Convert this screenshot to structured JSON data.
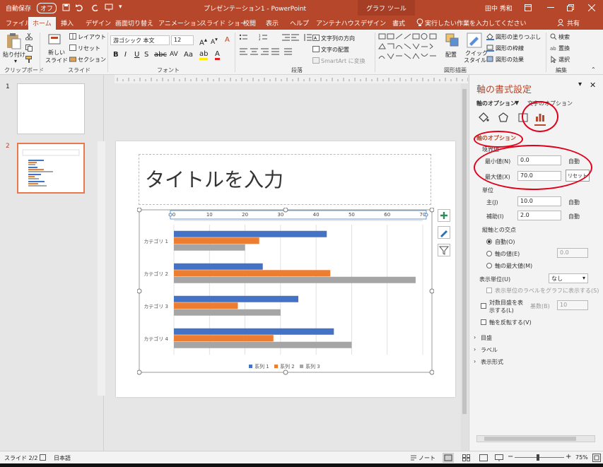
{
  "titlebar": {
    "autosave": "自動保存",
    "autosave_state": "オフ",
    "doc_title": "プレゼンテーション1 - PowerPoint",
    "context_tool": "グラフ ツール",
    "user": "田中 秀和"
  },
  "tabs": [
    "ファイル",
    "ホーム",
    "挿入",
    "デザイン",
    "画面切り替え",
    "アニメーション",
    "スライド ショー",
    "校閲",
    "表示",
    "ヘルプ",
    "アンテナハウス",
    "デザイン",
    "書式"
  ],
  "tell_me": "実行したい作業を入力してください",
  "share": "共有",
  "ribbon": {
    "clipboard": {
      "paste": "貼り付け",
      "group": "クリップボード"
    },
    "slides": {
      "new_slide": "新しい",
      "new_slide2": "スライド",
      "layout": "レイアウト",
      "reset": "リセット",
      "section": "セクション",
      "group": "スライド"
    },
    "font": {
      "name": "游ゴシック 本文",
      "size": "12",
      "group": "フォント"
    },
    "paragraph": {
      "text_dir": "文字列の方向",
      "align_text": "文字の配置",
      "smartart": "SmartArt に変換",
      "group": "段落"
    },
    "drawing": {
      "arrange": "配置",
      "quick_style": "クイック",
      "quick_style2": "スタイル",
      "fill": "図形の塗りつぶし",
      "outline": "図形の枠線",
      "effects": "図形の効果",
      "group": "図形描画"
    },
    "editing": {
      "find": "検索",
      "replace": "置換",
      "select": "選択",
      "group": "編集"
    }
  },
  "thumbnails": [
    {
      "num": "1"
    },
    {
      "num": "2"
    }
  ],
  "slide": {
    "title_placeholder": "タイトルを入力"
  },
  "chart_data": {
    "type": "bar",
    "orientation": "horizontal",
    "categories": [
      "カテゴリ 1",
      "カテゴリ 2",
      "カテゴリ 3",
      "カテゴリ 4"
    ],
    "series": [
      {
        "name": "系列 1",
        "color": "#4472c4",
        "values": [
          43,
          25,
          35,
          45
        ]
      },
      {
        "name": "系列 2",
        "color": "#ed7d31",
        "values": [
          24,
          44,
          18,
          28
        ]
      },
      {
        "name": "系列 3",
        "color": "#a5a5a5",
        "values": [
          20,
          68,
          30,
          50
        ]
      }
    ],
    "xlim": [
      0,
      70
    ],
    "ticks": [
      "0",
      "10",
      "20",
      "30",
      "40",
      "50",
      "60",
      "70"
    ],
    "axis_position": "top",
    "grid": true,
    "legend": "bottom"
  },
  "pane": {
    "title": "軸の書式設定",
    "tab_axis_options": "軸のオプション",
    "tab_text_options": "文字のオプション",
    "section_axis_options": "軸のオプション",
    "bounds": "境界値",
    "min_label": "最小値(N)",
    "min_value": "0.0",
    "min_auto": "自動",
    "max_label": "最大値(X)",
    "max_value": "70.0",
    "max_reset": "リセット",
    "units": "単位",
    "major_label": "主(J)",
    "major_value": "10.0",
    "major_auto": "自動",
    "minor_label": "補助(I)",
    "minor_value": "2.0",
    "minor_auto": "自動",
    "cross": "縦軸との交点",
    "cross_auto": "自動(O)",
    "cross_value": "軸の値(E)",
    "cross_value_num": "0.0",
    "cross_max": "軸の最大値(M)",
    "display_units": "表示単位(U)",
    "display_units_value": "なし",
    "show_units_label": "表示単位のラベルをグラフに表示する(S)",
    "log_scale": "対数目盛を表",
    "log_scale2": "示する(L)",
    "log_base_label": "基数(B)",
    "log_base_value": "10",
    "reverse": "軸を反転する(V)",
    "tick_marks": "目盛",
    "labels": "ラベル",
    "number": "表示形式"
  },
  "status": {
    "slide": "スライド 2/2",
    "lang": "日本語",
    "notes": "ノート",
    "zoom": "75%"
  }
}
